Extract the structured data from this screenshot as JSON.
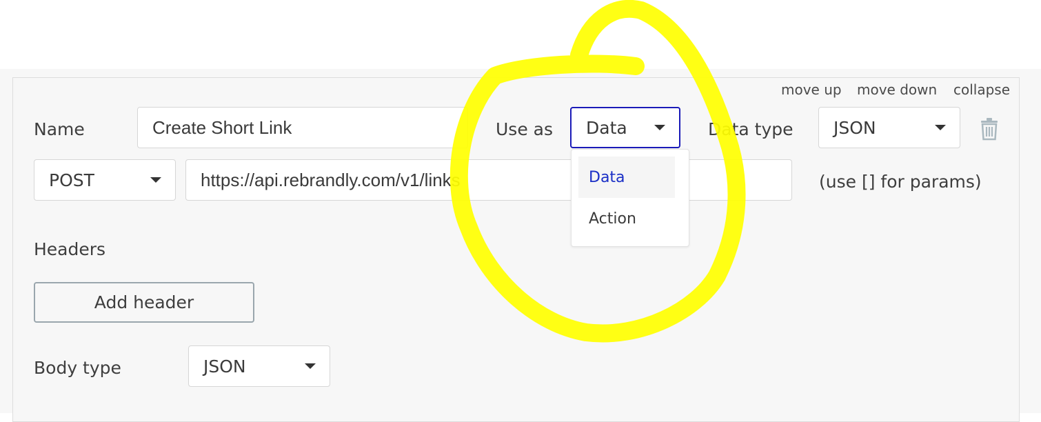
{
  "header_links": {
    "move_up": "move up",
    "move_down": "move down",
    "collapse": "collapse"
  },
  "form": {
    "name_label": "Name",
    "name_value": "Create Short Link",
    "use_as_label": "Use as",
    "use_as_value": "Data",
    "data_type_label": "Data type",
    "data_type_value": "JSON",
    "method_value": "POST",
    "url_value": "https://api.rebrandly.com/v1/links",
    "params_hint": "(use [] for params)",
    "headers_label": "Headers",
    "add_header_label": "Add header",
    "body_type_label": "Body type",
    "body_type_value": "JSON"
  },
  "use_as_menu": {
    "options": [
      {
        "label": "Data",
        "selected": true
      },
      {
        "label": "Action",
        "selected": false
      }
    ]
  },
  "icons": {
    "delete": "trash-icon",
    "dropdown": "caret-down-icon"
  },
  "colors": {
    "accent": "#1a1ab8",
    "selected_option": "#1a2fc6",
    "highlight": "#ffff00"
  }
}
